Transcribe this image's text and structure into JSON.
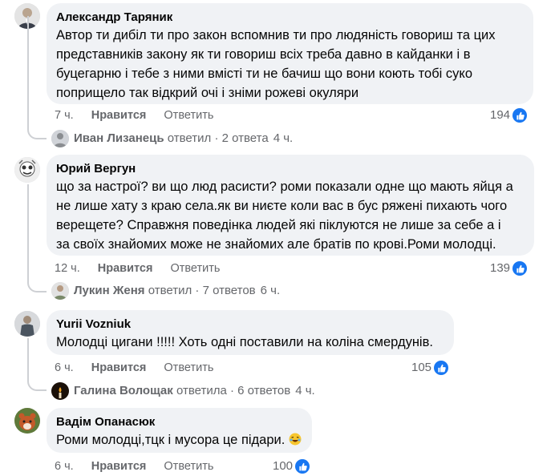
{
  "labels": {
    "like": "Нравится",
    "reply": "Ответить"
  },
  "comments": [
    {
      "author": "Александр Таряник",
      "lines": [
        "Автор ти дибіл ти про закон вспомнив ти про людяність говориш та цих",
        "представників закону як ти говориш всіх треба давно в кайданки і в",
        "буцегарню і тебе з ними вмісті ти не бачиш що вони коють тобі суко",
        "поприщело так відкрий очі і зніми рожеві окуляри"
      ],
      "time": "7 ч.",
      "reactions": "194",
      "reply_summary": {
        "name": "Иван Лизанець",
        "text": "ответил · 2 ответа",
        "time": "4 ч."
      }
    },
    {
      "author": "Юрий Вергун",
      "lines": [
        "що за настрої? ви що люд расисти? роми показали одне що мають яйця а",
        "не лише хату з краю села.як ви ниєте коли вас в бус ряжені пихають чого",
        "верещете? Справжня поведінка людей які піклуются не лише за себе а і",
        "за своїх знайомих може не знайомих але братів по крові.Роми молодці."
      ],
      "time": "12 ч.",
      "reactions": "139",
      "reply_summary": {
        "name": "Лукин Женя",
        "text": "ответил · 7 ответов",
        "time": "6 ч."
      }
    },
    {
      "author": "Yurii Vozniuk",
      "lines": [
        "Молодці цигани !!!!! Хоть одні поставили на коліна смердунів."
      ],
      "time": "6 ч.",
      "reactions": "105",
      "reply_summary": {
        "name": "Галина Волощак",
        "text": "ответила · 6 ответов",
        "time": "4 ч."
      }
    },
    {
      "author": "Вадім Опанасюк",
      "lines": [
        "Роми молодці,тцк і мусора це підари."
      ],
      "time": "6 ч.",
      "reactions": "100"
    }
  ],
  "colors": {
    "like_blue": "#1877f2",
    "bubble": "#f0f2f5",
    "meta": "#65676b"
  }
}
